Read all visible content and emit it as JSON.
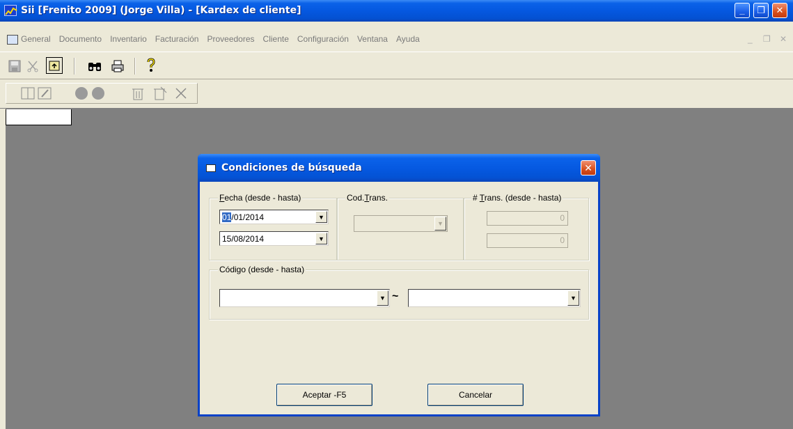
{
  "window": {
    "title": "Sii [Frenito 2009] (Jorge Villa) - [Kardex de cliente]",
    "minimize_glyph": "_",
    "maximize_glyph": "❐",
    "close_glyph": "✕"
  },
  "menu": {
    "items": [
      "General",
      "Documento",
      "Inventario",
      "Facturación",
      "Proveedores",
      "Cliente",
      "Configuración",
      "Ventana",
      "Ayuda"
    ],
    "mdi_minimize": "_",
    "mdi_restore": "❐",
    "mdi_close": "✕"
  },
  "toolbar1": {
    "icons": [
      "save-icon",
      "cut-icon",
      "paste-icon",
      "binoculars-icon",
      "print-icon",
      "help-icon"
    ]
  },
  "toolbar2": {
    "icons": [
      "first-record-icon",
      "edit-record-icon",
      "prev-circle-icon",
      "next-circle-icon",
      "trash-icon",
      "delete-all-icon",
      "cancel-x-icon"
    ]
  },
  "dialog": {
    "title": "Condiciones de búsqueda",
    "close_glyph": "✕",
    "fecha": {
      "label_mnemonic": "F",
      "label_rest": "echa (desde - hasta)",
      "from_selected": "01",
      "from_rest": "/01/2014",
      "to": "15/08/2014"
    },
    "cod_trans": {
      "label_pre": "Cod.",
      "label_mnemonic": "T",
      "label_rest": "rans.",
      "value": ""
    },
    "num_trans": {
      "label_pre": "# ",
      "label_mnemonic": "T",
      "label_rest": "rans. (desde - hasta)",
      "from": "0",
      "to": "0"
    },
    "codigo": {
      "label": "Código (desde - hasta)",
      "from": "",
      "to": "",
      "separator": "~"
    },
    "accept_label": "Aceptar -F5",
    "cancel_label": "Cancelar"
  }
}
